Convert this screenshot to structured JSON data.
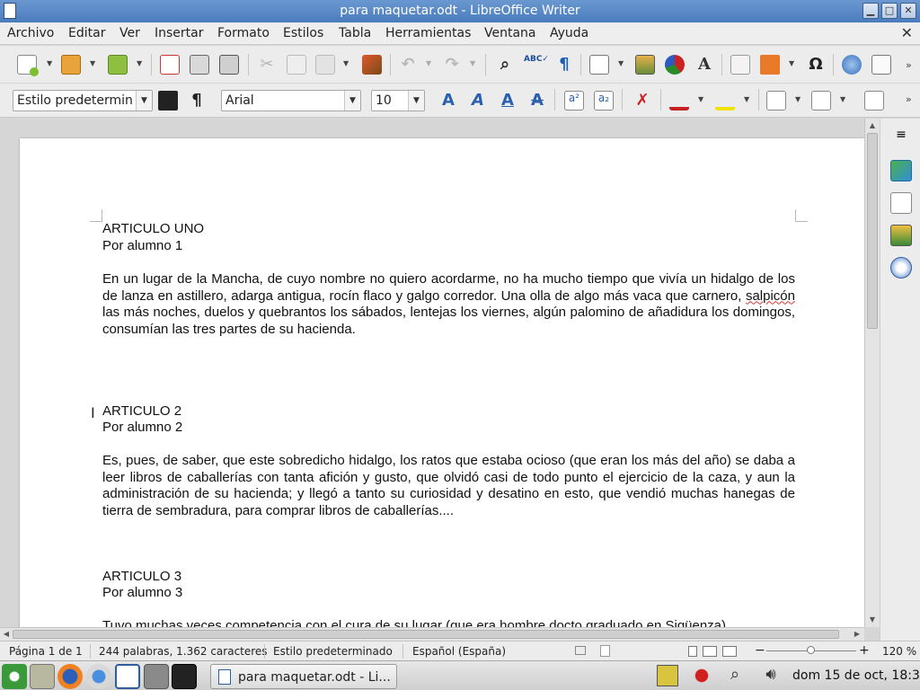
{
  "window": {
    "title": "para maquetar.odt - LibreOffice Writer"
  },
  "menu": [
    "Archivo",
    "Editar",
    "Ver",
    "Insertar",
    "Formato",
    "Estilos",
    "Tabla",
    "Herramientas",
    "Ventana",
    "Ayuda"
  ],
  "format_bar": {
    "paragraph_style": "Estilo predetermin",
    "font_name": "Arial",
    "font_size": "10"
  },
  "document": {
    "articles": [
      {
        "heading": "ARTICULO UNO",
        "author": "Por alumno 1",
        "body_before": "En un lugar de la Mancha, de cuyo nombre no quiero acordarme, no ha mucho tiempo que vivía un hidalgo de los de lanza en astillero, adarga antigua, rocín flaco y galgo corredor. Una olla de algo más vaca que carnero, ",
        "misspelled": "salpicón",
        "body_after": " las más noches, duelos y quebrantos los sábados, lentejas los viernes, algún palomino de añadidura los domingos, consumían las tres partes de su hacienda."
      },
      {
        "heading": "ARTICULO 2",
        "author": "Por alumno 2",
        "body": "Es, pues, de saber, que este sobredicho hidalgo, los ratos que estaba ocioso (que eran los más del año) se daba a leer libros de caballerías con tanta afición y gusto, que olvidó casi de todo punto el ejercicio de la caza, y aun la administración de su hacienda; y llegó a tanto su curiosidad y desatino en esto, que vendió muchas hanegas de tierra de sembradura, para comprar libros de caballerías...."
      },
      {
        "heading": "ARTICULO 3",
        "author": "Por alumno 3",
        "body": "Tuvo muchas veces competencia con el cura de su lugar (que era hombre docto graduado en Sigüenza),"
      }
    ]
  },
  "statusbar": {
    "page": "Página 1 de 1",
    "counts": "244 palabras, 1.362 caracteres",
    "page_style": "Estilo predeterminado",
    "language": "Español (España)",
    "zoom": "120 %"
  },
  "taskbar": {
    "window_label": "para maquetar.odt - Li...",
    "clock": "dom 15 de oct, 18:32"
  }
}
